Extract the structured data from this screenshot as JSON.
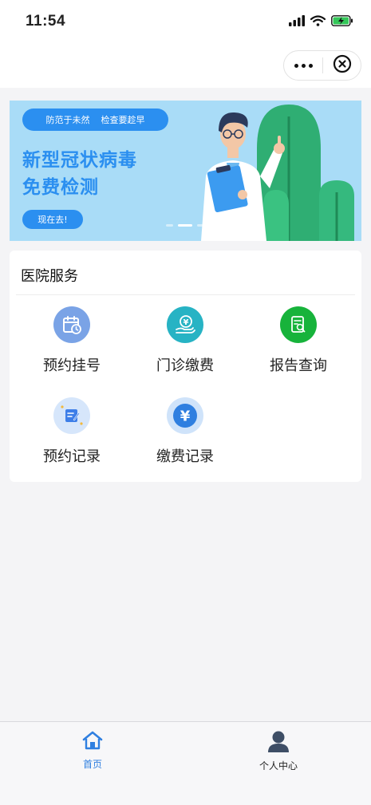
{
  "status": {
    "time": "11:54"
  },
  "banner": {
    "tag_left": "防范于未然",
    "tag_right": "检查要趁早",
    "headline_1": "新型冠状病毒",
    "headline_2": "免费检测",
    "cta": "现在去!"
  },
  "services": {
    "title": "医院服务",
    "items": [
      {
        "label": "预约挂号",
        "icon": "calendar-clock-icon",
        "color": "#6f9be3"
      },
      {
        "label": "门诊缴费",
        "icon": "hand-yen-icon",
        "color": "#27b3c4"
      },
      {
        "label": "报告查询",
        "icon": "report-search-icon",
        "color": "#17b33b"
      },
      {
        "label": "预约记录",
        "icon": "note-edit-icon",
        "color": "#3d7ee8"
      },
      {
        "label": "缴费记录",
        "icon": "yen-coin-icon",
        "color": "#2f7fe0"
      }
    ]
  },
  "tabbar": {
    "home": "首页",
    "profile": "个人中心",
    "active_color": "#2f7fe0"
  }
}
